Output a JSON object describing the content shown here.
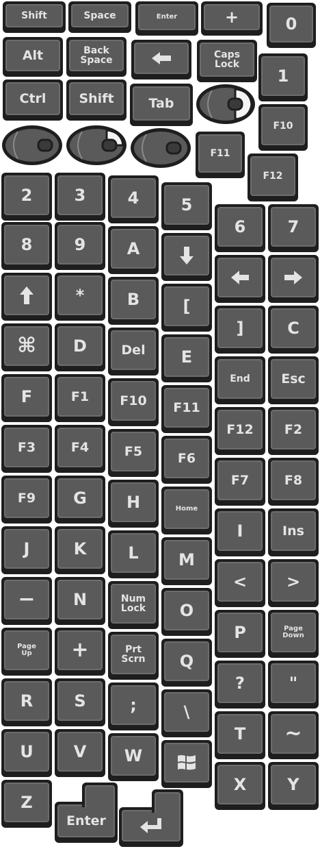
{
  "keys": {
    "shift_top": "Shift",
    "space": "Space",
    "enter_small": "Enter",
    "plus_top": "+",
    "zero": "0",
    "alt": "Alt",
    "backspace": "Back\nSpace",
    "capslock": "Caps\nLock",
    "one": "1",
    "ctrl": "Ctrl",
    "shift_mid": "Shift",
    "tab": "Tab",
    "f10_top": "F10",
    "f11_top": "F11",
    "f12_top": "F12",
    "k2": "2",
    "k3": "3",
    "k4": "4",
    "k5": "5",
    "k6": "6",
    "k7": "7",
    "k8": "8",
    "k9": "9",
    "kA": "A",
    "star": "*",
    "kB": "B",
    "lbracket": "[",
    "cmd": "⌘",
    "kD": "D",
    "del": "Del",
    "kE": "E",
    "rbracket": "]",
    "kC": "C",
    "kF": "F",
    "f1": "F1",
    "f10": "F10",
    "f11": "F11",
    "end": "End",
    "esc": "Esc",
    "f3": "F3",
    "f4": "F4",
    "f5": "F5",
    "f6": "F6",
    "f12": "F12",
    "f2": "F2",
    "f9": "F9",
    "kG": "G",
    "kH": "H",
    "home": "Home",
    "f7": "F7",
    "f8": "F8",
    "kJ": "J",
    "kK": "K",
    "kL": "L",
    "kM": "M",
    "kI": "I",
    "ins": "Ins",
    "minus": "−",
    "kN": "N",
    "numlock": "Num\nLock",
    "kO": "O",
    "lt": "<",
    "gt": ">",
    "pageup": "Page\nUp",
    "plus": "+",
    "prtscrn": "Prt\nScrn",
    "kQ": "Q",
    "kP": "P",
    "pagedown": "Page\nDown",
    "kR": "R",
    "kS": "S",
    "semicolon": ";",
    "backslash": "\\",
    "question": "?",
    "quote": "\"",
    "kU": "U",
    "kV": "V",
    "kW": "W",
    "kT": "T",
    "tilde": "~",
    "kX": "X",
    "kY": "Y",
    "kZ": "Z",
    "enter_big": "Enter"
  }
}
